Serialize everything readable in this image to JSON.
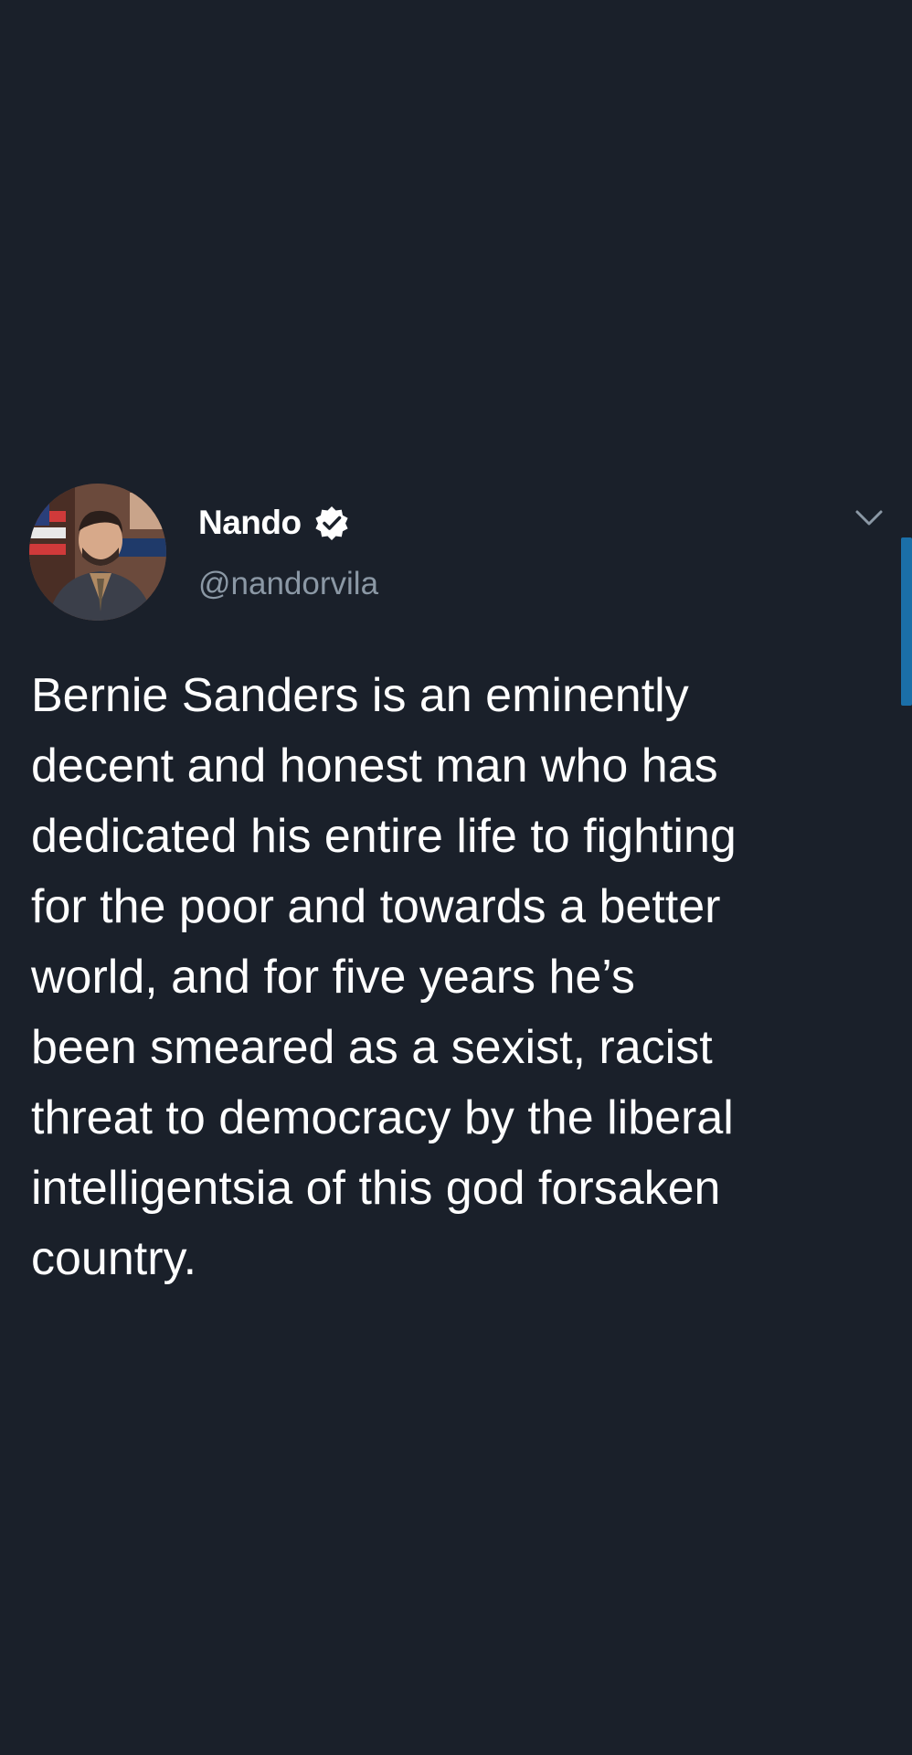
{
  "tweet": {
    "author": {
      "display_name": "Nando",
      "handle": "@nandorvila",
      "verified": true,
      "avatar_icon": "profile-photo"
    },
    "text_lines": [
      "Bernie Sanders is an eminently",
      "decent and honest man who has",
      "dedicated his entire life to fighting",
      "for the poor and towards a better",
      "world, and for five years he’s",
      "been smeared as a sexist, racist",
      "threat to democracy by the liberal",
      "intelligentsia of this god forsaken",
      "country."
    ],
    "menu_icon": "chevron-down-icon"
  },
  "colors": {
    "background": "#1a202a",
    "text_primary": "#ffffff",
    "text_secondary": "#8b98a5",
    "scroll_indicator": "#1b6fa8"
  }
}
